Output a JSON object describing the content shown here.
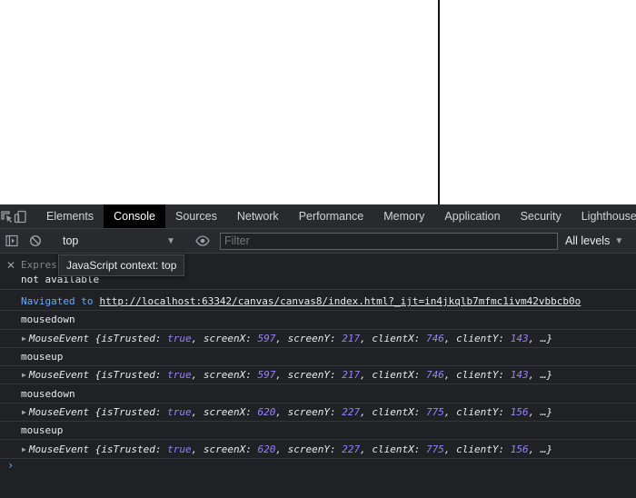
{
  "devtools": {
    "tabs": [
      {
        "label": "Elements"
      },
      {
        "label": "Console"
      },
      {
        "label": "Sources"
      },
      {
        "label": "Network"
      },
      {
        "label": "Performance"
      },
      {
        "label": "Memory"
      },
      {
        "label": "Application"
      },
      {
        "label": "Security"
      },
      {
        "label": "Lighthouse"
      }
    ],
    "active_tab": "Console",
    "icons": {
      "inspect": "inspect-element-icon",
      "device": "device-toolbar-icon",
      "sidebar": "console-sidebar-icon",
      "clear": "clear-console-icon",
      "eye": "live-expression-icon"
    },
    "toolbar": {
      "context_value": "top",
      "filter_placeholder": "Filter",
      "levels_label": "All levels"
    },
    "live_expression": {
      "label": "Express",
      "value": "not available",
      "tooltip": "JavaScript context: top"
    },
    "log": {
      "navigated_prefix": "Navigated to",
      "navigated_url": "http://localhost:63342/canvas/canvas8/index.html?_ijt=in4jkqlb7mfmc1ivm42vbbcb0o",
      "entries": [
        {
          "event": "mousedown",
          "obj": {
            "name": "MouseEvent",
            "isTrusted": "true",
            "screenX": "597",
            "screenY": "217",
            "clientX": "746",
            "clientY": "143"
          }
        },
        {
          "event": "mouseup",
          "obj": {
            "name": "MouseEvent",
            "isTrusted": "true",
            "screenX": "597",
            "screenY": "217",
            "clientX": "746",
            "clientY": "143"
          }
        },
        {
          "event": "mousedown",
          "obj": {
            "name": "MouseEvent",
            "isTrusted": "true",
            "screenX": "620",
            "screenY": "227",
            "clientX": "775",
            "clientY": "156"
          }
        },
        {
          "event": "mouseup",
          "obj": {
            "name": "MouseEvent",
            "isTrusted": "true",
            "screenX": "620",
            "screenY": "227",
            "clientX": "775",
            "clientY": "156"
          }
        }
      ],
      "ellipsis": "…}",
      "prompt": "›"
    },
    "colors": {
      "panel_bg": "#202124",
      "toolbar_bg": "#292a2d",
      "link_blue": "#6ea6f9",
      "value_purple": "#9980ff"
    }
  }
}
